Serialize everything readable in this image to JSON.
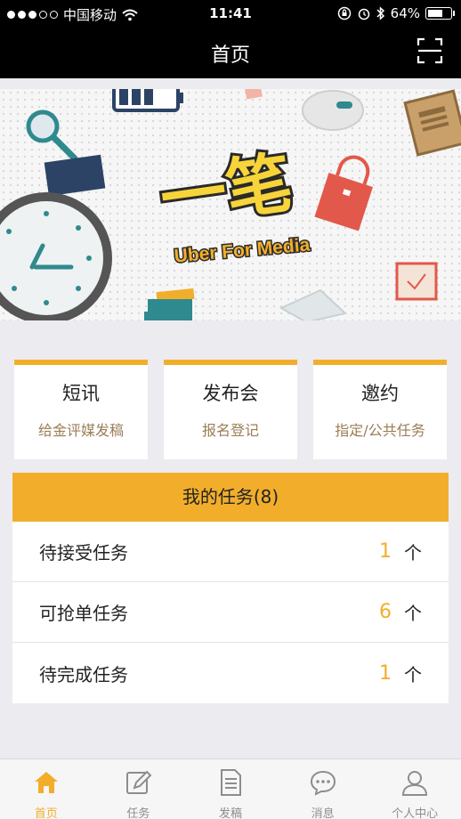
{
  "status_bar": {
    "carrier": "中国移动",
    "time": "11:41",
    "battery": "64%",
    "battery_level": 0.64,
    "signal_bars": 3
  },
  "nav": {
    "title": "首页",
    "scan_icon": "scan-icon"
  },
  "banner": {
    "title": "一笔",
    "subtitle": "Uber For Media"
  },
  "cards": [
    {
      "title": "短讯",
      "subtitle": "给金评媒发稿"
    },
    {
      "title": "发布会",
      "subtitle": "报名登记"
    },
    {
      "title": "邀约",
      "subtitle": "指定/公共任务"
    }
  ],
  "tasks": {
    "header": "我的任务(8)",
    "rows": [
      {
        "label": "待接受任务",
        "count": "1",
        "unit": "个"
      },
      {
        "label": "可抢单任务",
        "count": "6",
        "unit": "个"
      },
      {
        "label": "待完成任务",
        "count": "1",
        "unit": "个"
      }
    ]
  },
  "tabs": [
    {
      "label": "首页",
      "icon": "home-icon",
      "active": true
    },
    {
      "label": "任务",
      "icon": "edit-icon",
      "active": false
    },
    {
      "label": "发稿",
      "icon": "document-icon",
      "active": false
    },
    {
      "label": "消息",
      "icon": "message-icon",
      "active": false
    },
    {
      "label": "个人中心",
      "icon": "user-icon",
      "active": false
    }
  ],
  "colors": {
    "accent": "#f2ae2b",
    "topbar": "#000000",
    "background": "#ecebf0"
  }
}
